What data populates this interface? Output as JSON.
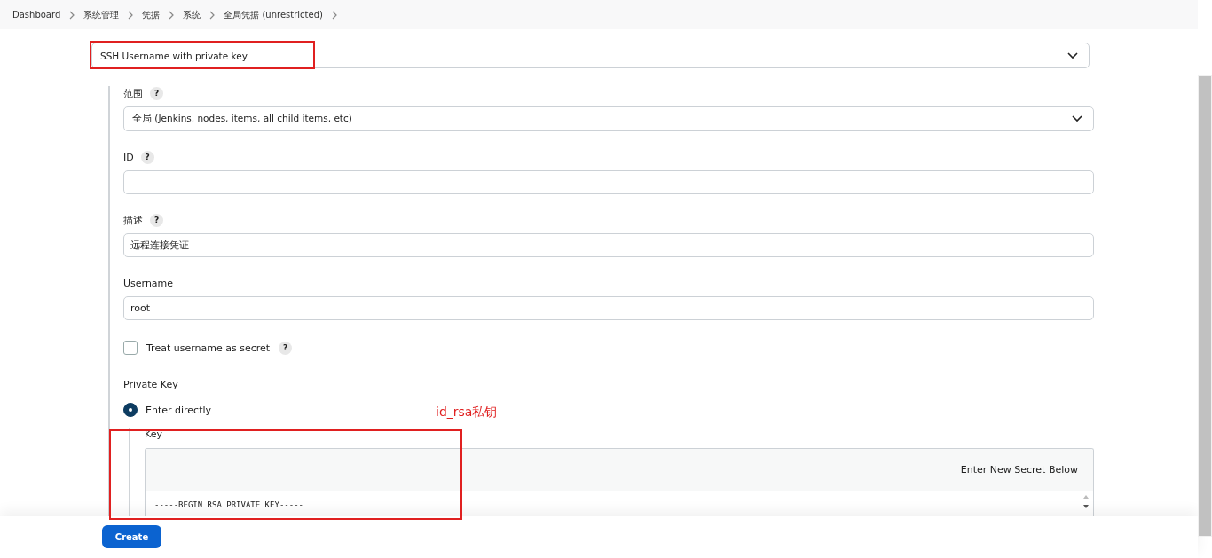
{
  "breadcrumbs": [
    "Dashboard",
    "系统管理",
    "凭据",
    "系统",
    "全局凭据 (unrestricted)"
  ],
  "kind_select": {
    "value": "SSH Username with private key"
  },
  "scope": {
    "label": "范围",
    "help": "?",
    "value": "全局 (Jenkins, nodes, items, all child items, etc)"
  },
  "id": {
    "label": "ID",
    "help": "?"
  },
  "description": {
    "label": "描述",
    "help": "?",
    "value": "远程连接凭证"
  },
  "username": {
    "label": "Username",
    "value": "root"
  },
  "treat_secret": {
    "label": "Treat username as secret",
    "help": "?",
    "checked": false
  },
  "private_key": {
    "label": "Private Key",
    "option": {
      "label": "Enter directly",
      "selected": true
    },
    "key_label": "Key",
    "secret_hint": "Enter New Secret Below",
    "key_lines": [
      "-----BEGIN RSA PRIVATE KEY-----"
    ]
  },
  "annotation": {
    "text": "id_rsa私钥"
  },
  "create_button": "Create"
}
